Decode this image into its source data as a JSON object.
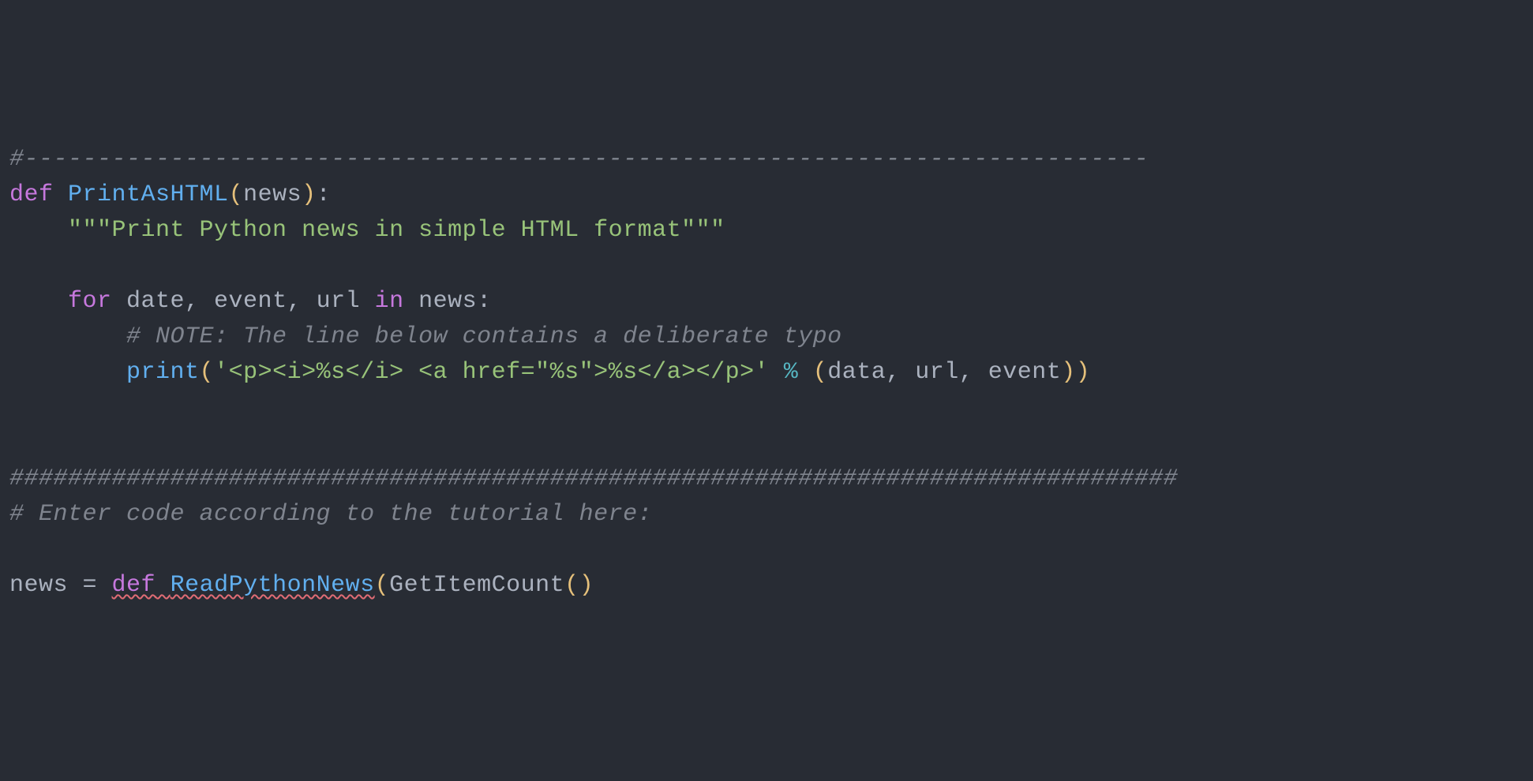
{
  "code": {
    "line1": {
      "comment": "#-----------------------------------------------------------------------------"
    },
    "line2": {
      "def": "def",
      "funcname": "PrintAsHTML",
      "lparen": "(",
      "param": "news",
      "rparen": ")",
      "colon": ":"
    },
    "line3": {
      "docstring": "\"\"\"Print Python news in simple HTML format\"\"\""
    },
    "line4": {
      "for": "for",
      "vars": " date, event, url ",
      "in": "in",
      "iter": " news",
      "colon": ":"
    },
    "line5": {
      "comment": "# NOTE: The line below contains a deliberate typo"
    },
    "line6": {
      "print": "print",
      "lparen": "(",
      "string": "'<p><i>%s</i> <a href=\"%s\">%s</a></p>'",
      "mod": " % ",
      "lparen2": "(",
      "args": "data, url, event",
      "rparen2": ")",
      "rparen": ")"
    },
    "line7": {
      "comment": "################################################################################"
    },
    "line8": {
      "comment": "# Enter code according to the tutorial here:"
    },
    "line9": {
      "news": "news",
      "equals": " = ",
      "def": "def",
      "space": " ",
      "funcname": "ReadPythonNews",
      "lparen": "(",
      "arg": "GetItemCount",
      "lparen2": "(",
      "rparen2": ")"
    }
  }
}
